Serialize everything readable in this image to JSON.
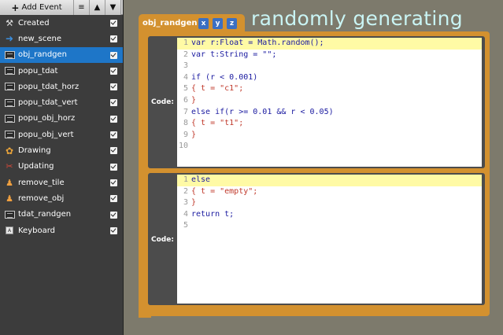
{
  "toolbar": {
    "add_event_label": "Add Event",
    "add_icon": "+",
    "menu_icon": "≡",
    "up_icon": "▲",
    "down_icon": "▼"
  },
  "events": [
    {
      "label": "Created",
      "icon": "wand-icon",
      "selected": false,
      "enabled": true
    },
    {
      "label": "new_scene",
      "icon": "arrow-right-icon",
      "selected": false,
      "enabled": true
    },
    {
      "label": "obj_randgen",
      "icon": "box-icon",
      "selected": true,
      "enabled": true
    },
    {
      "label": "popu_tdat",
      "icon": "box-icon",
      "selected": false,
      "enabled": true
    },
    {
      "label": "popu_tdat_horz",
      "icon": "box-icon",
      "selected": false,
      "enabled": true
    },
    {
      "label": "popu_tdat_vert",
      "icon": "box-icon",
      "selected": false,
      "enabled": true
    },
    {
      "label": "popu_obj_horz",
      "icon": "box-icon",
      "selected": false,
      "enabled": true
    },
    {
      "label": "popu_obj_vert",
      "icon": "box-icon",
      "selected": false,
      "enabled": true
    },
    {
      "label": "Drawing",
      "icon": "palette-icon",
      "selected": false,
      "enabled": true
    },
    {
      "label": "Updating",
      "icon": "hammer-icon",
      "selected": false,
      "enabled": true
    },
    {
      "label": "remove_tile",
      "icon": "person-icon",
      "selected": false,
      "enabled": true
    },
    {
      "label": "remove_obj",
      "icon": "person-icon",
      "selected": false,
      "enabled": true
    },
    {
      "label": "tdat_randgen",
      "icon": "box-icon",
      "selected": false,
      "enabled": true
    },
    {
      "label": "Keyboard",
      "icon": "keyboard-icon",
      "selected": false,
      "enabled": true
    }
  ],
  "block": {
    "name": "obj_randgen",
    "params": [
      "x",
      "y",
      "z"
    ],
    "comment": "randomly generating",
    "accent_color": "#d3912f"
  },
  "code_sections": [
    {
      "label": "Code:",
      "lines": [
        {
          "n": "1",
          "text": "var r:Float = Math.random();",
          "hl": true
        },
        {
          "n": "2",
          "text": "var t:String = \"\";",
          "hl": false
        },
        {
          "n": "3",
          "text": "",
          "hl": false
        },
        {
          "n": "4",
          "text": "if (r < 0.001)",
          "hl": false
        },
        {
          "n": "5",
          "text": "{ t = \"c1\";",
          "hl": false
        },
        {
          "n": "6",
          "text": "}",
          "hl": false
        },
        {
          "n": "7",
          "text": "else if(r >= 0.01 && r < 0.05)",
          "hl": false
        },
        {
          "n": "8",
          "text": "{ t = \"t1\";",
          "hl": false
        },
        {
          "n": "9",
          "text": "}",
          "hl": false
        },
        {
          "n": "10",
          "text": "",
          "hl": false
        }
      ]
    },
    {
      "label": "Code:",
      "lines": [
        {
          "n": "1",
          "text": "else",
          "hl": true
        },
        {
          "n": "2",
          "text": "{ t = \"empty\";",
          "hl": false
        },
        {
          "n": "3",
          "text": "}",
          "hl": false
        },
        {
          "n": "4",
          "text": "return t;",
          "hl": false
        },
        {
          "n": "5",
          "text": "",
          "hl": false
        }
      ]
    }
  ]
}
